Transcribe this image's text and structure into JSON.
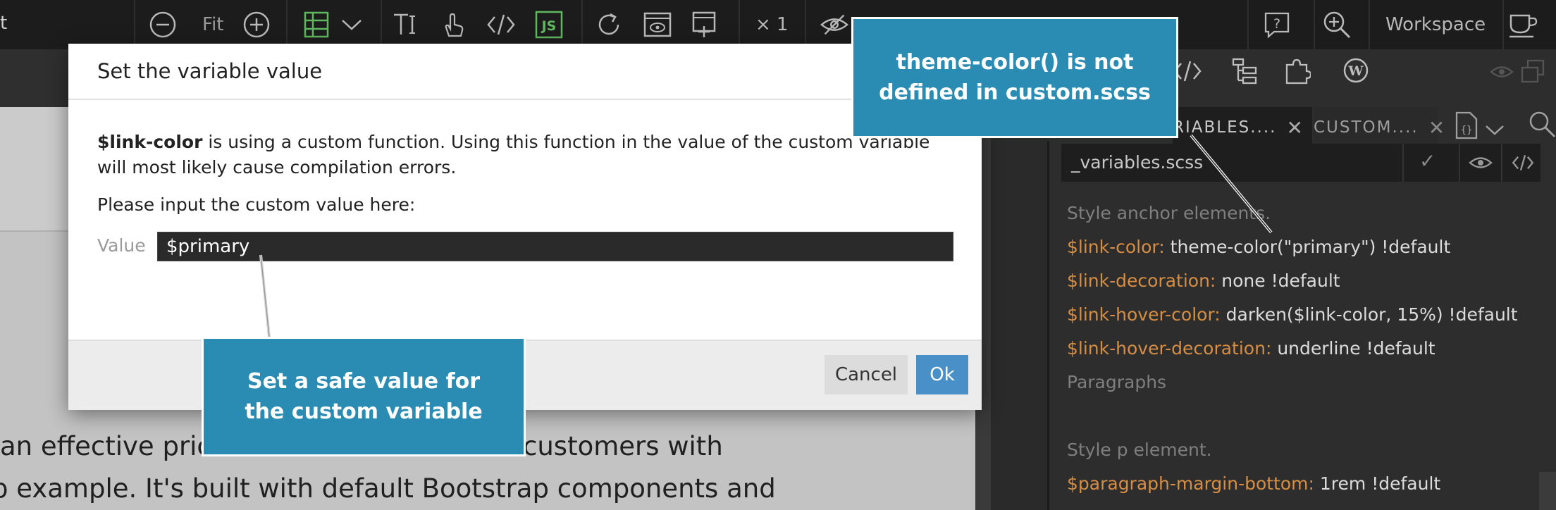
{
  "toolbar": {
    "app_title_fragment": "t",
    "zoom_label": "Fit",
    "multiplier_label": "× 1",
    "workspace_label": "Workspace"
  },
  "page_preview": {
    "line1": "an effective prici",
    "line1b": "customers with",
    "line2": "p example. It's built with default Bootstrap components and"
  },
  "right_panel": {
    "tabs": [
      {
        "label": "RIABLES...."
      },
      {
        "label": "CUSTOM...."
      }
    ],
    "file_name": "_variables.scss",
    "code_lines": [
      {
        "type": "comment",
        "text": "Style anchor elements."
      },
      {
        "type": "var",
        "name": "$link-color",
        "value": "theme-color(\"primary\") !default"
      },
      {
        "type": "var",
        "name": "$link-decoration",
        "value": "none !default"
      },
      {
        "type": "var",
        "name": "$link-hover-color",
        "value": "darken($link-color, 15%) !default"
      },
      {
        "type": "var",
        "name": "$link-hover-decoration",
        "value": "underline !default"
      },
      {
        "type": "comment",
        "text": "Paragraphs"
      },
      {
        "type": "comment",
        "text": ""
      },
      {
        "type": "comment",
        "text": "Style p element."
      },
      {
        "type": "var",
        "name": "$paragraph-margin-bottom",
        "value": "1rem !default"
      }
    ]
  },
  "dialog": {
    "title": "Set the variable value",
    "message_bold": "$link-color",
    "message_rest": " is using a custom function. Using this function in the value of the custom variable will most likely cause compilation errors.",
    "prompt": "Please input the custom value here:",
    "value_label": "Value",
    "value": "$primary",
    "cancel_label": "Cancel",
    "ok_label": "Ok"
  },
  "callouts": {
    "top_right": "theme-color() is not defined in custom.scss",
    "bottom": "Set a safe value for the custom variable"
  },
  "colors": {
    "callout_bg": "#2b8cb3",
    "variable_orange": "#d58e44",
    "ok_button": "#4a90c8"
  },
  "icons": [
    "minus-circle-icon",
    "plus-circle-icon",
    "grid-icon",
    "chevron-down-icon",
    "text-cursor-icon",
    "touch-icon",
    "code-icon",
    "js-icon",
    "refresh-icon",
    "preview-icon",
    "add-panel-icon",
    "eye-off-icon",
    "help-icon",
    "zoom-in-icon",
    "cup-icon",
    "code-tag-icon",
    "tree-icon",
    "puzzle-icon",
    "wordpress-icon",
    "eye-icon",
    "window-icon",
    "close-icon",
    "file-code-icon",
    "search-icon",
    "check-icon"
  ]
}
